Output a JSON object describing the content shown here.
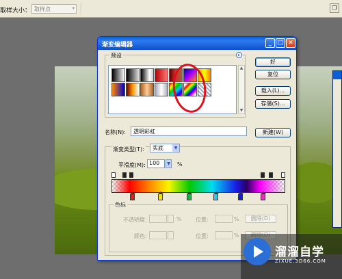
{
  "optbar": {
    "sample_size_label": "取样大小：",
    "sample_value": "取样点"
  },
  "dialog": {
    "title": "渐变编辑器",
    "presets_label": "预设",
    "buttons": {
      "ok": "好",
      "reset": "复位",
      "load": "载入(L)...",
      "save": "存储(S)...",
      "new": "新建(W)"
    },
    "name_label": "名称(N):",
    "name_value": "透明彩虹",
    "gradient_type_label": "渐变类型(T):",
    "gradient_type_value": "实底",
    "smoothness_label": "平滑度(M):",
    "smoothness_value": "100",
    "smoothness_unit": "%",
    "stops_label": "色标",
    "opacity_label": "不透明度:",
    "opacity_unit": "%",
    "location_label": "位置:",
    "location_unit": "%",
    "delete_label": "删除(D)",
    "color_label": "颜色:",
    "location2_label": "位置:",
    "location2_unit": "%",
    "delete2_label": "删除(D)"
  },
  "watermark": {
    "name": "溜溜自学",
    "url": "ZIXUE.3D66.COM"
  },
  "colors": {
    "titlebar": "#0a5fd8",
    "annotation_circle": "#e0101a"
  },
  "icons": [
    "presets-menu-icon",
    "minimize-icon",
    "maximize-icon",
    "close-icon",
    "dropdown-arrow-icon",
    "play-logo-icon"
  ]
}
